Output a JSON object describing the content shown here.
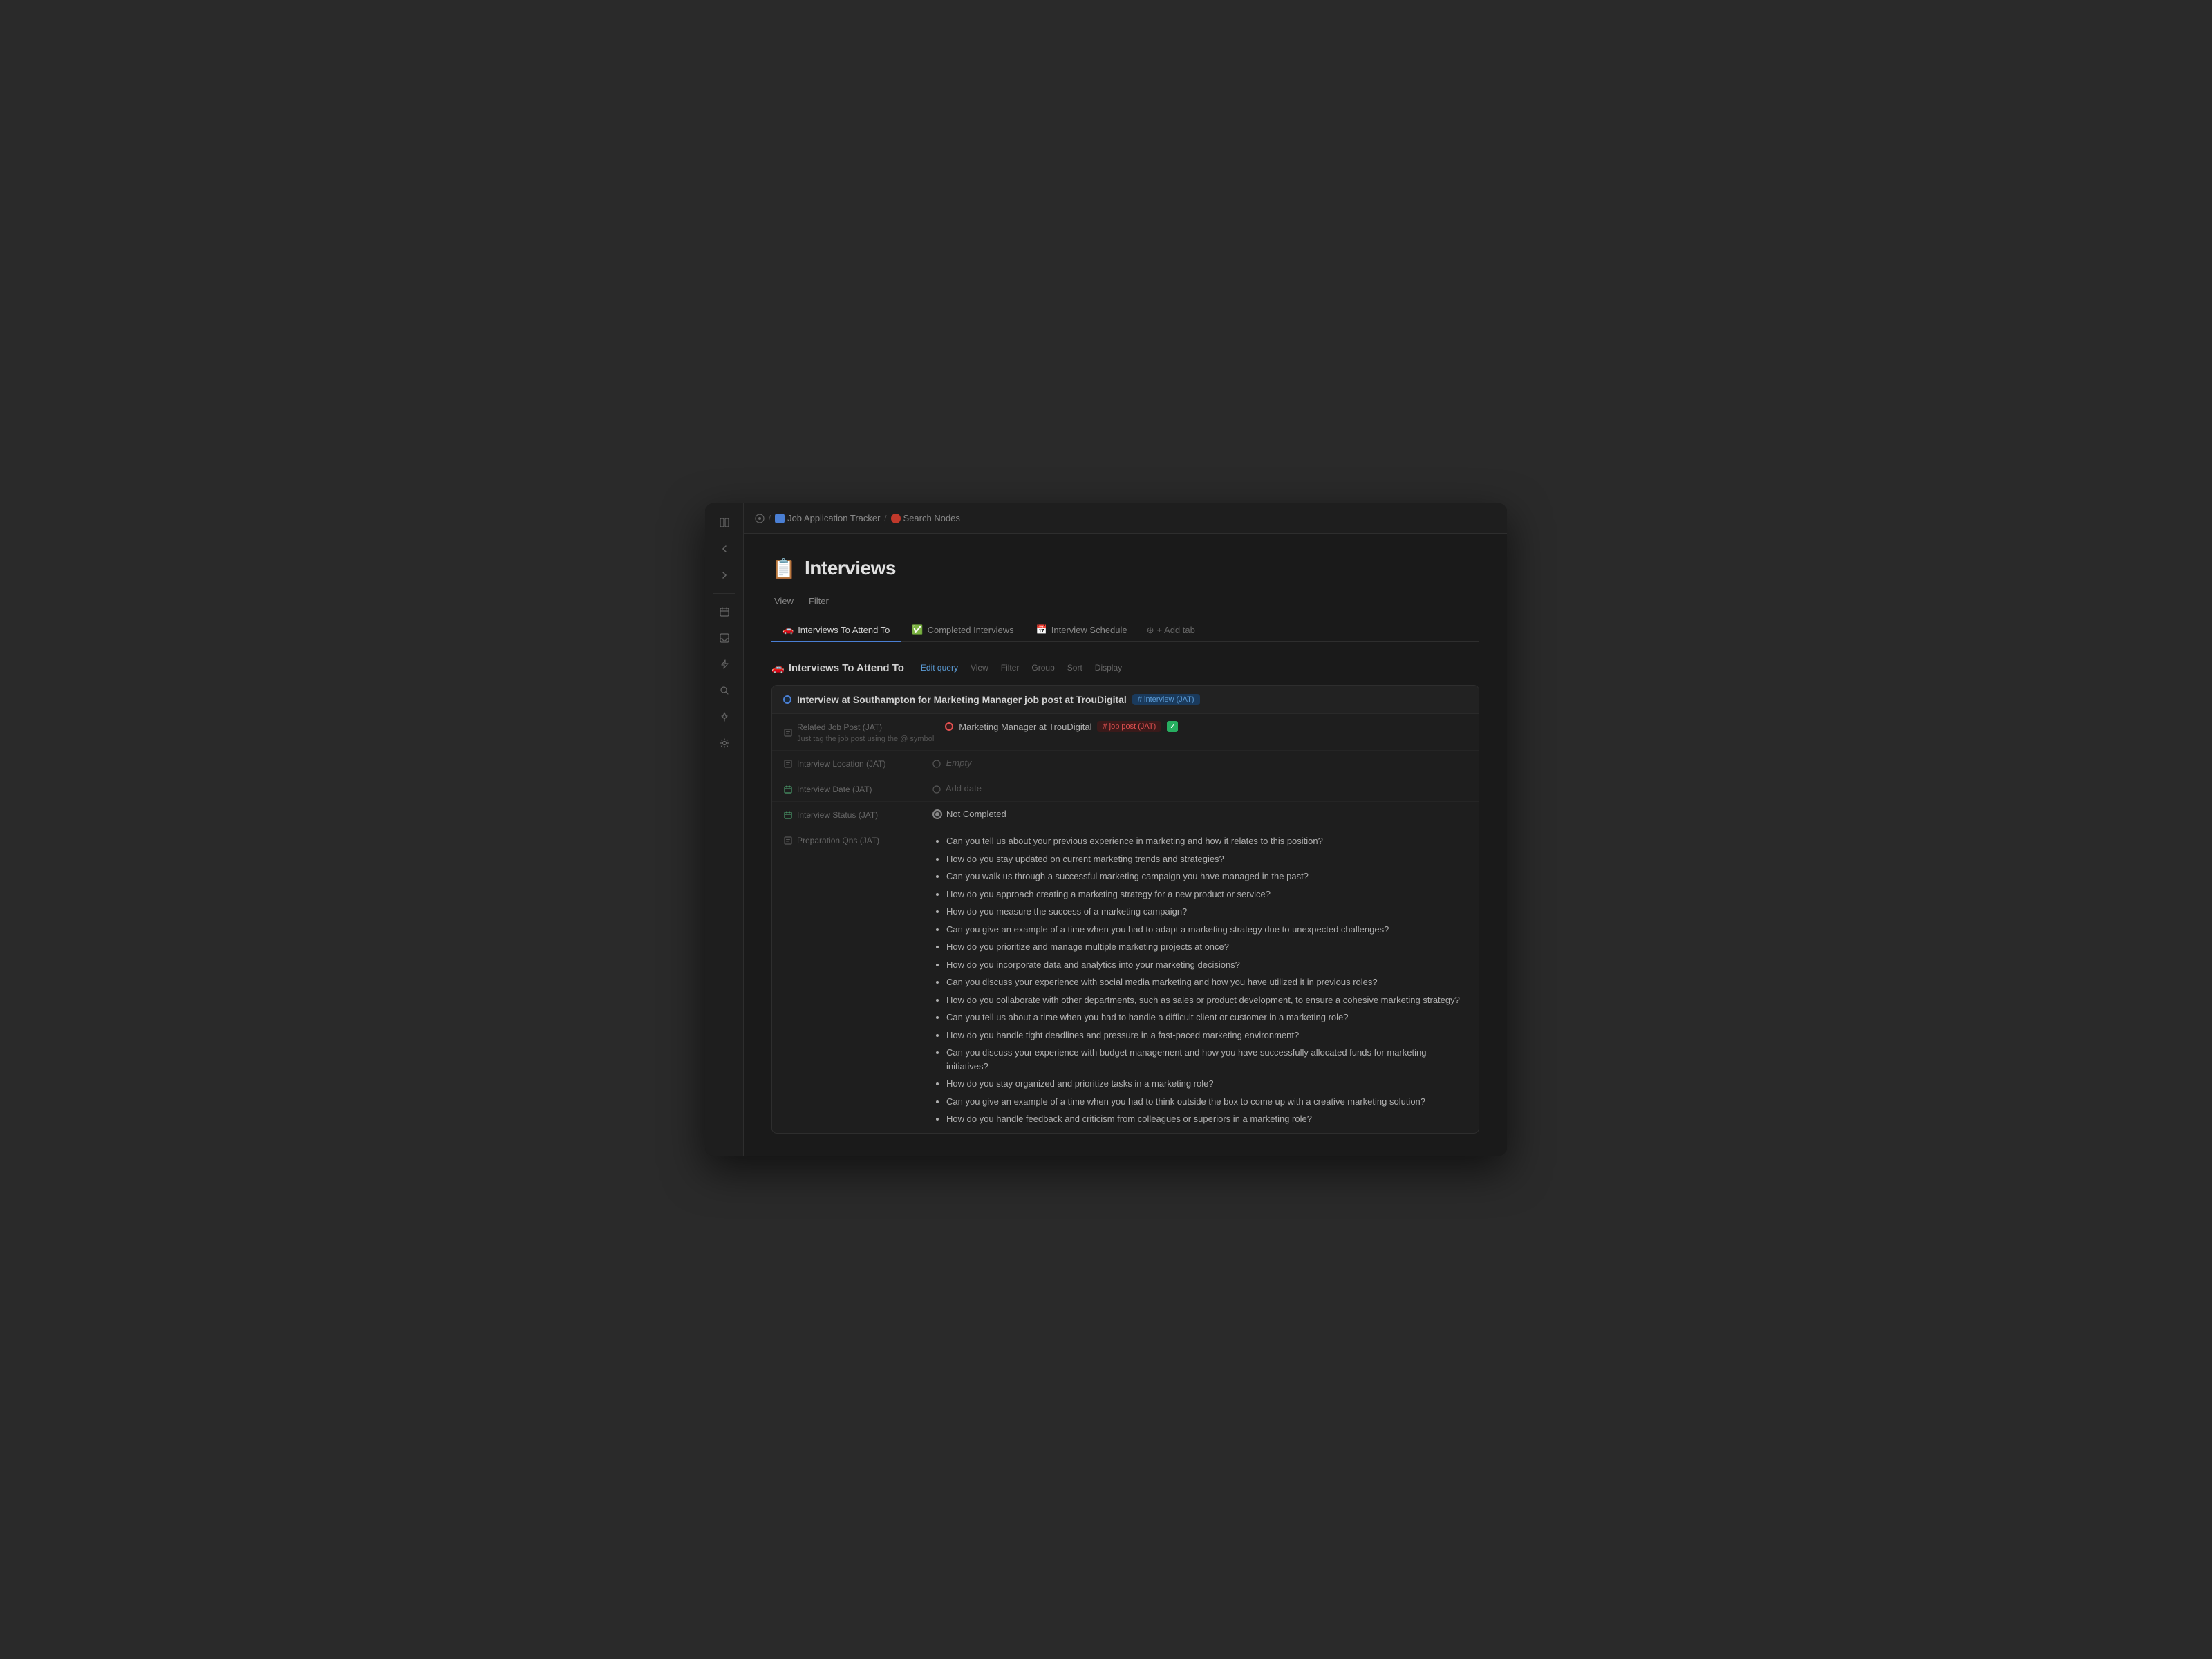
{
  "window": {
    "title": "Interviews"
  },
  "titlebar": {
    "breadcrumbs": [
      {
        "icon": "grid-icon",
        "label": "Job Application Tracker"
      },
      {
        "icon": "nodes-icon",
        "label": "Search Nodes"
      }
    ]
  },
  "page": {
    "icon": "📋",
    "title": "Interviews",
    "view_label": "View",
    "filter_label": "Filter"
  },
  "tabs": [
    {
      "id": "interviews-to-attend",
      "label": "Interviews To Attend To",
      "icon": "🚗",
      "active": true
    },
    {
      "id": "completed-interviews",
      "label": "Completed Interviews",
      "icon": "✅",
      "active": false
    },
    {
      "id": "interview-schedule",
      "label": "Interview Schedule",
      "icon": "📅",
      "active": false
    },
    {
      "id": "add-tab",
      "label": "+ Add tab",
      "icon": "",
      "active": false
    }
  ],
  "section": {
    "icon": "🚗",
    "title": "Interviews To Attend To",
    "actions": {
      "edit_query": "Edit query",
      "view": "View",
      "filter": "Filter",
      "group": "Group",
      "sort": "Sort",
      "display": "Display"
    }
  },
  "interview": {
    "title": "Interview at Southampton for Marketing Manager job post at TrouDigital",
    "tag": "# interview (JAT)",
    "properties": {
      "related_job_post": {
        "label": "Related Job Post (JAT)",
        "hint": "Just tag the job post using the @ symbol",
        "value": "Marketing Manager at TrouDigital",
        "tag": "# job post (JAT)",
        "has_check": true
      },
      "interview_location": {
        "label": "Interview Location (JAT)",
        "value": "Empty"
      },
      "interview_date": {
        "label": "Interview Date (JAT)",
        "value": "Add date"
      },
      "interview_status": {
        "label": "Interview Status (JAT)",
        "value": "Not Completed"
      },
      "preparation_qns": {
        "label": "Preparation Qns (JAT)",
        "questions": [
          "Can you tell us about your previous experience in marketing and how it relates to this position?",
          "How do you stay updated on current marketing trends and strategies?",
          "Can you walk us through a successful marketing campaign you have managed in the past?",
          "How do you approach creating a marketing strategy for a new product or service?",
          "How do you measure the success of a marketing campaign?",
          "Can you give an example of a time when you had to adapt a marketing strategy due to unexpected challenges?",
          "How do you prioritize and manage multiple marketing projects at once?",
          "How do you incorporate data and analytics into your marketing decisions?",
          "Can you discuss your experience with social media marketing and how you have utilized it in previous roles?",
          "How do you collaborate with other departments, such as sales or product development, to ensure a cohesive marketing strategy?",
          "Can you tell us about a time when you had to handle a difficult client or customer in a marketing role?",
          "How do you handle tight deadlines and pressure in a fast-paced marketing environment?",
          "Can you discuss your experience with budget management and how you have successfully allocated funds for marketing initiatives?",
          "How do you stay organized and prioritize tasks in a marketing role?",
          "Can you give an example of a time when you had to think outside the box to come up with a creative marketing solution?",
          "How do you handle feedback and criticism from colleagues or superiors in a marketing role?"
        ]
      }
    }
  }
}
